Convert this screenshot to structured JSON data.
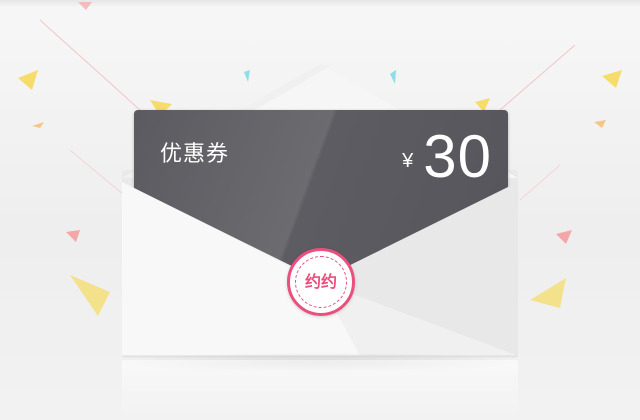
{
  "coupon": {
    "title": "优惠券",
    "currency_symbol": "¥",
    "amount": "30"
  },
  "seal": {
    "text": "约约",
    "color": "#ea4f7e"
  },
  "colors": {
    "card_dark": "#5a5a60",
    "envelope": "#f7f7f7",
    "confetti_yellow": "#f6dc6a",
    "confetti_pink": "#f3a7a7",
    "confetti_cyan": "#8fdde6"
  },
  "icons": [
    "confetti-pieces",
    "wax-seal-icon"
  ]
}
